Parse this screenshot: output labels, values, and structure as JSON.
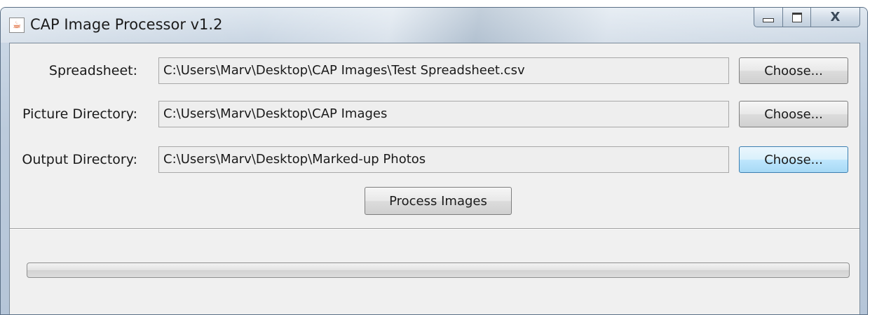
{
  "window": {
    "title": "CAP Image Processor v1.2",
    "close_glyph": "X",
    "icons": [
      "java-cup-icon",
      "minimize-icon",
      "maximize-icon",
      "close-icon"
    ]
  },
  "form": {
    "spreadsheet": {
      "label": "Spreadsheet:",
      "value": "C:\\Users\\Marv\\Desktop\\CAP Images\\Test Spreadsheet.csv",
      "button": "Choose..."
    },
    "picture_directory": {
      "label": "Picture Directory:",
      "value": "C:\\Users\\Marv\\Desktop\\CAP Images",
      "button": "Choose..."
    },
    "output_directory": {
      "label": "Output Directory:",
      "value": "C:\\Users\\Marv\\Desktop\\Marked-up Photos",
      "button": "Choose..."
    },
    "process_button": "Process Images"
  },
  "progress": {
    "value": 0
  },
  "colors": {
    "focused_button": "#bee6fd",
    "client_background": "#f0f0f0"
  }
}
